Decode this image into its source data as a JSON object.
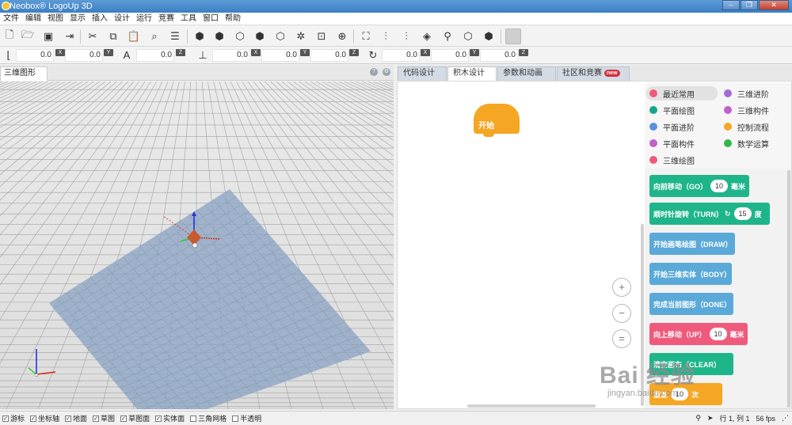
{
  "app": {
    "title": "Neobox® LogoUp 3D"
  },
  "menu": [
    "文件",
    "编辑",
    "视图",
    "显示",
    "插入",
    "设计",
    "运行",
    "竞赛",
    "工具",
    "窗口",
    "帮助"
  ],
  "toolbar": {
    "icons": [
      "new-file-icon",
      "open-folder-icon",
      "save-icon",
      "import-icon",
      "cut-icon",
      "copy-icon",
      "paste-icon",
      "search-icon",
      "list-icon",
      "cube-front-icon",
      "cube-right-icon",
      "cube-top-icon",
      "cube-iso-icon",
      "cube-gear-icon",
      "fit-view-icon",
      "axis-icon",
      "fullscreen-icon",
      "caliper-icon",
      "ruler-icon",
      "paint-bucket-icon",
      "pin-icon",
      "cube-add-icon",
      "cube-wire-icon",
      "stop-icon"
    ]
  },
  "coords": {
    "move": [
      "0.0",
      "0.0",
      "0.0"
    ],
    "scale": [
      "0.0",
      "0.0",
      "0.0"
    ],
    "rotate": [
      "0.0",
      "0.0",
      "0.0"
    ],
    "axes": [
      "X",
      "Y",
      "Z"
    ]
  },
  "left_panel": {
    "tab": "三维图形"
  },
  "right_panel": {
    "tabs": [
      "代码设计",
      "积木设计",
      "参数和动画",
      "社区和竞赛"
    ],
    "new_badge": "new",
    "start_block": "开始"
  },
  "categories": [
    {
      "label": "最近常用",
      "color": "#ef5a7c"
    },
    {
      "label": "三维进阶",
      "color": "#a36bd8"
    },
    {
      "label": "平面绘图",
      "color": "#17a589"
    },
    {
      "label": "三维构件",
      "color": "#c160c9"
    },
    {
      "label": "平面进阶",
      "color": "#5a8fe0"
    },
    {
      "label": "控制流程",
      "color": "#f5a623"
    },
    {
      "label": "平面构件",
      "color": "#c160c9"
    },
    {
      "label": "数学运算",
      "color": "#34b64a"
    },
    {
      "label": "三维绘图",
      "color": "#ef5a7c"
    }
  ],
  "blocks": {
    "go": {
      "label": "向前移动（GO）",
      "value": "10",
      "unit": "毫米"
    },
    "turn": {
      "label": "顺时针旋转（TURN）",
      "value": "15",
      "unit": "度"
    },
    "draw": {
      "label": "开始画笔绘图（DRAW）"
    },
    "body": {
      "label": "开始三维实体（BODY）"
    },
    "done": {
      "label": "完成当前图形（DONE）"
    },
    "up": {
      "label": "向上移动（UP）",
      "value": "10",
      "unit": "毫米"
    },
    "clear": {
      "label": "清空画布（CLEAR）"
    },
    "repeat": {
      "label": "重复",
      "value": "10",
      "suffix": "次"
    }
  },
  "zoom": [
    "+",
    "−",
    "="
  ],
  "watermark": {
    "main": "Bai 经验",
    "sub": "jingyan.baidu.com"
  },
  "status": {
    "checks": [
      {
        "label": "游标",
        "checked": true
      },
      {
        "label": "坐标轴",
        "checked": true
      },
      {
        "label": "地面",
        "checked": true
      },
      {
        "label": "草图",
        "checked": true
      },
      {
        "label": "草图面",
        "checked": true
      },
      {
        "label": "实体面",
        "checked": true
      },
      {
        "label": "三角网格",
        "checked": false
      },
      {
        "label": "半透明",
        "checked": false
      }
    ],
    "position": "行 1, 列 1",
    "fps": "56 fps"
  },
  "check_mark": "✓"
}
